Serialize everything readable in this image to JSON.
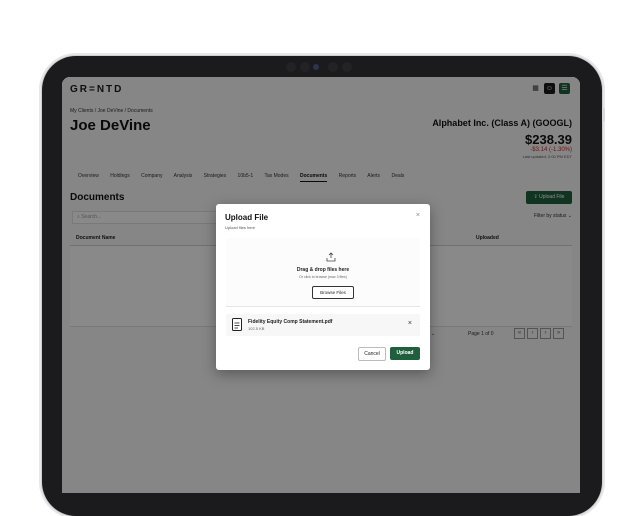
{
  "app": {
    "logo": "GR=NTD",
    "header_icons": [
      "grid-icon",
      "user-icon",
      "menu-icon"
    ]
  },
  "breadcrumb": "My Clients  /  Joe DeVine  /  Documents",
  "client_name": "Joe DeVine",
  "stock": {
    "name": "Alphabet Inc. (Class A) (GOOGL)",
    "price": "$238.39",
    "change": "-$3.14  (-1.30%)",
    "updated": "Last updated: 2:00 PM EDT"
  },
  "tabs": [
    "Overview",
    "Holdings",
    "Company",
    "Analysis",
    "Strategies",
    "10b5-1",
    "Tax Modes",
    "Documents",
    "Reports",
    "Alerts",
    "Deals"
  ],
  "active_tab": "Documents",
  "documents": {
    "title": "Documents",
    "upload_button": "Upload File",
    "search_placeholder": "Search...",
    "filter_label": "Filter by status",
    "columns": [
      "Document Name",
      "Uploaded"
    ],
    "rows_label": "10",
    "page_label": "Page 1 of 0"
  },
  "modal": {
    "title": "Upload File",
    "subtitle": "Upload files here",
    "close": "×",
    "drop_text": "Drag & drop files here",
    "drop_sub": "Or click to browse (max 3 files)",
    "browse_label": "Browse Files",
    "file": {
      "name": "Fidelity Equity Comp Statement.pdf",
      "size": "102.5 KB"
    },
    "remove": "×",
    "cancel_label": "Cancel",
    "upload_label": "Upload"
  },
  "colors": {
    "brand_green": "#1f5f3e",
    "negative": "#c62828"
  }
}
